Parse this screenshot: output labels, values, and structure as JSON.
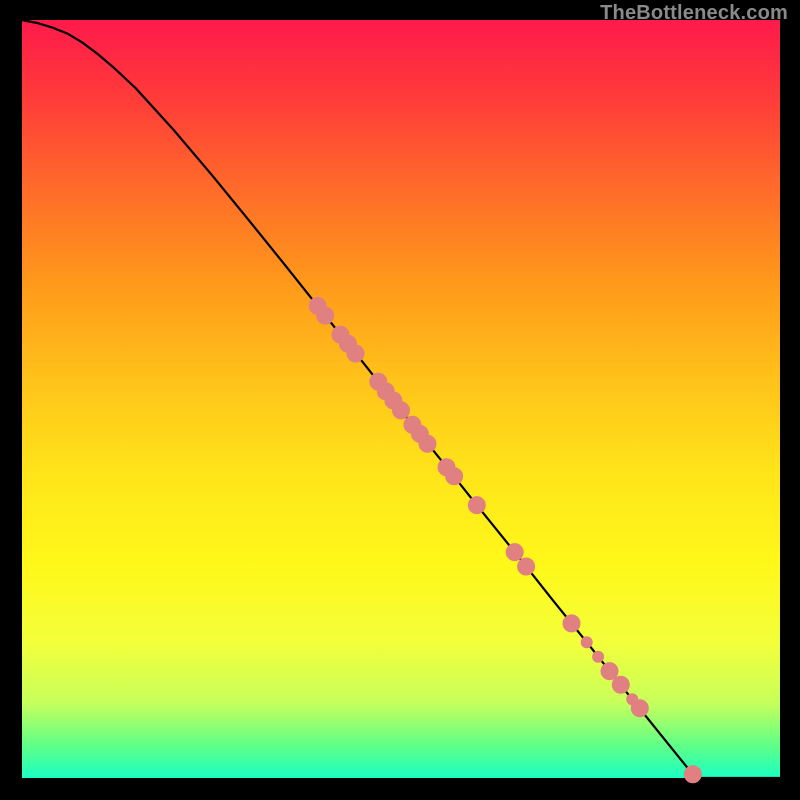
{
  "watermark": "TheBottleneck.com",
  "chart_data": {
    "type": "line",
    "title": "",
    "xlabel": "",
    "ylabel": "",
    "xlim": [
      0,
      100
    ],
    "ylim": [
      0,
      100
    ],
    "gradient_stops": [
      {
        "pos": 0.0,
        "color": "#ff1a4b"
      },
      {
        "pos": 0.1,
        "color": "#ff3a3a"
      },
      {
        "pos": 0.22,
        "color": "#ff6a2a"
      },
      {
        "pos": 0.35,
        "color": "#ff9a1a"
      },
      {
        "pos": 0.48,
        "color": "#ffc41a"
      },
      {
        "pos": 0.6,
        "color": "#ffe51a"
      },
      {
        "pos": 0.72,
        "color": "#fff81a"
      },
      {
        "pos": 0.82,
        "color": "#f3ff3a"
      },
      {
        "pos": 0.9,
        "color": "#c8ff5a"
      },
      {
        "pos": 0.96,
        "color": "#5aff8a"
      },
      {
        "pos": 1.0,
        "color": "#1affc4"
      }
    ],
    "series": [
      {
        "name": "curve",
        "type": "line",
        "stroke": "#000000",
        "x": [
          0,
          2,
          4,
          6,
          8,
          10,
          12,
          15,
          20,
          25,
          30,
          35,
          40,
          45,
          50,
          55,
          60,
          65,
          70,
          75,
          80,
          85,
          88,
          89,
          92,
          96,
          100
        ],
        "y": [
          100,
          99.6,
          99.0,
          98.2,
          97.0,
          95.5,
          93.8,
          91.0,
          85.5,
          79.6,
          73.5,
          67.3,
          61.0,
          54.8,
          48.5,
          42.3,
          36.0,
          29.8,
          23.5,
          17.3,
          11.0,
          4.8,
          1.1,
          0.0,
          0.0,
          0.0,
          0.0
        ]
      },
      {
        "name": "scatter-large",
        "type": "scatter",
        "size": "large",
        "fill": "#e08080",
        "stroke": "#e08080",
        "points": [
          {
            "x": 39.0,
            "y": 62.3
          },
          {
            "x": 40.0,
            "y": 61.0
          },
          {
            "x": 42.0,
            "y": 58.5
          },
          {
            "x": 43.0,
            "y": 57.3
          },
          {
            "x": 44.0,
            "y": 56.0
          },
          {
            "x": 47.0,
            "y": 52.3
          },
          {
            "x": 48.0,
            "y": 51.0
          },
          {
            "x": 49.0,
            "y": 49.8
          },
          {
            "x": 50.0,
            "y": 48.5
          },
          {
            "x": 51.5,
            "y": 46.6
          },
          {
            "x": 52.5,
            "y": 45.4
          },
          {
            "x": 53.5,
            "y": 44.1
          },
          {
            "x": 56.0,
            "y": 41.0
          },
          {
            "x": 57.0,
            "y": 39.8
          },
          {
            "x": 60.0,
            "y": 36.0
          },
          {
            "x": 65.0,
            "y": 29.8
          },
          {
            "x": 66.5,
            "y": 27.9
          },
          {
            "x": 72.5,
            "y": 20.4
          },
          {
            "x": 77.5,
            "y": 14.1
          },
          {
            "x": 79.0,
            "y": 12.3
          },
          {
            "x": 81.5,
            "y": 9.2
          },
          {
            "x": 88.5,
            "y": 0.5
          }
        ]
      },
      {
        "name": "scatter-small",
        "type": "scatter",
        "size": "small",
        "fill": "#e08080",
        "stroke": "#e08080",
        "points": [
          {
            "x": 74.5,
            "y": 17.9
          },
          {
            "x": 76.0,
            "y": 16.0
          },
          {
            "x": 80.5,
            "y": 10.4
          }
        ]
      }
    ]
  }
}
